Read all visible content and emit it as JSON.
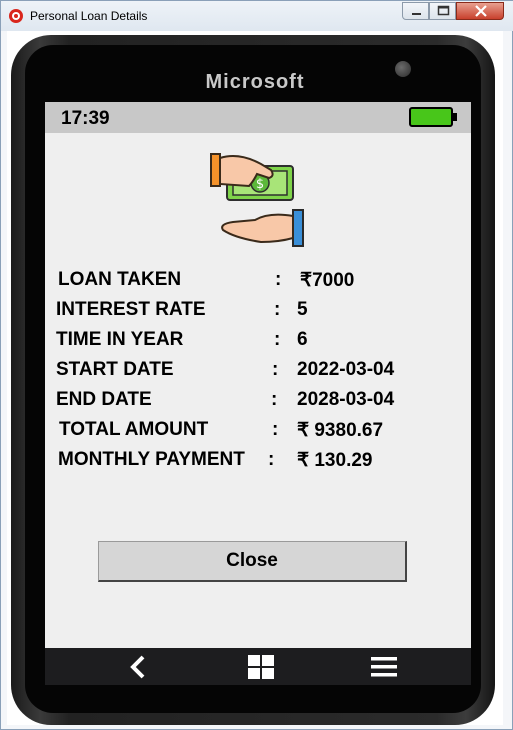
{
  "window": {
    "title": "Personal Loan Details"
  },
  "phone": {
    "brand": "Microsoft"
  },
  "status_bar": {
    "time": "17:39"
  },
  "details": [
    {
      "label": "LOAN TAKEN",
      "colon": ":",
      "value": "₹7000"
    },
    {
      "label": "INTEREST RATE",
      "colon": ":",
      "value": "5"
    },
    {
      "label": "TIME IN YEAR",
      "colon": ":",
      "value": "6"
    },
    {
      "label": "START DATE",
      "colon": ":",
      "value": "2022-03-04"
    },
    {
      "label": "END DATE",
      "colon": ":",
      "value": "2028-03-04"
    },
    {
      "label": "TOTAL AMOUNT",
      "colon": ":",
      "value": "₹ 9380.67"
    },
    {
      "label": "MONTHLY PAYMENT",
      "colon": ":",
      "value": "₹ 130.29"
    }
  ],
  "close_button": {
    "label": "Close"
  },
  "nav": {
    "back_icon": "back-arrow-icon",
    "home_icon": "windows-grid-icon",
    "menu_icon": "hamburger-menu-icon"
  },
  "colors": {
    "battery": "#48c61a",
    "screen_bg": "#efefef",
    "status_bar": "#c8c8c8",
    "navbar": "#1d1d1f"
  }
}
